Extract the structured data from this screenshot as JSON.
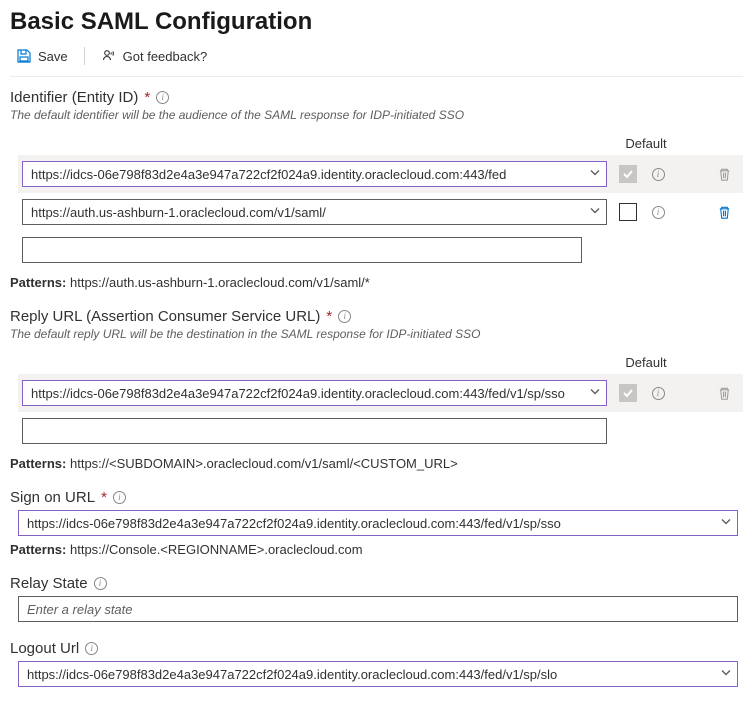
{
  "page_title": "Basic SAML Configuration",
  "toolbar": {
    "save_label": "Save",
    "feedback_label": "Got feedback?"
  },
  "identifier": {
    "label": "Identifier (Entity ID)",
    "required": true,
    "desc": "The default identifier will be the audience of the SAML response for IDP-initiated SSO",
    "default_col": "Default",
    "rows": [
      {
        "value": "https://idcs-06e798f83d2e4a3e947a722cf2f024a9.identity.oraclecloud.com:443/fed",
        "default": true,
        "active": true,
        "delete_disabled": true,
        "has_checkbox": true,
        "has_chevron": true
      },
      {
        "value": "https://auth.us-ashburn-1.oraclecloud.com/v1/saml/",
        "default": false,
        "active": false,
        "delete_disabled": false,
        "has_checkbox": true,
        "has_chevron": true
      },
      {
        "value": "",
        "has_checkbox": false,
        "has_chevron": false
      }
    ],
    "patterns_label": "Patterns:",
    "patterns_value": "https://auth.us-ashburn-1.oraclecloud.com/v1/saml/*"
  },
  "reply": {
    "label": "Reply URL (Assertion Consumer Service URL)",
    "required": true,
    "desc": "The default reply URL will be the destination in the SAML response for IDP-initiated SSO",
    "default_col": "Default",
    "rows": [
      {
        "value": "https://idcs-06e798f83d2e4a3e947a722cf2f024a9.identity.oraclecloud.com:443/fed/v1/sp/sso",
        "default": true,
        "active": true,
        "delete_disabled": true,
        "has_checkbox": true,
        "has_chevron": true
      },
      {
        "value": "",
        "has_checkbox": false,
        "has_chevron": false
      }
    ],
    "patterns_label": "Patterns:",
    "patterns_value": "https://<SUBDOMAIN>.oraclecloud.com/v1/saml/<CUSTOM_URL>"
  },
  "signon": {
    "label": "Sign on URL",
    "required": true,
    "value": "https://idcs-06e798f83d2e4a3e947a722cf2f024a9.identity.oraclecloud.com:443/fed/v1/sp/sso",
    "patterns_label": "Patterns:",
    "patterns_value": "https://Console.<REGIONNAME>.oraclecloud.com"
  },
  "relay": {
    "label": "Relay State",
    "placeholder": "Enter a relay state",
    "value": ""
  },
  "logout": {
    "label": "Logout Url",
    "value": "https://idcs-06e798f83d2e4a3e947a722cf2f024a9.identity.oraclecloud.com:443/fed/v1/sp/slo"
  }
}
